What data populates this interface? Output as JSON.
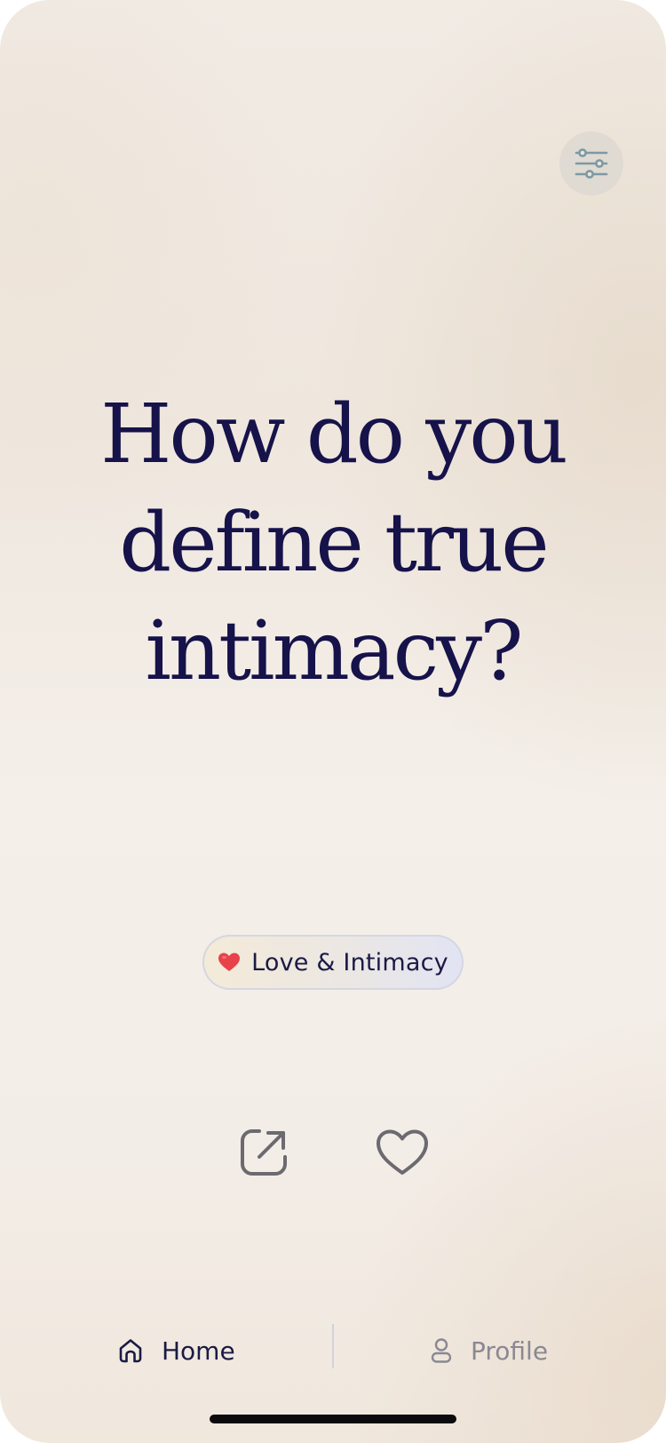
{
  "question": {
    "line1": "How do you",
    "line2": "define true",
    "line3": "intimacy?"
  },
  "category": {
    "emoji": "heart-emoji",
    "label": "Love & Intimacy"
  },
  "toolbar": {
    "filter_icon": "sliders-icon"
  },
  "actions": {
    "share_icon": "share-icon",
    "like_icon": "heart-icon"
  },
  "tabbar": {
    "home": {
      "label": "Home",
      "icon": "home-icon",
      "active": true
    },
    "profile": {
      "label": "Profile",
      "icon": "user-icon",
      "active": false
    }
  },
  "colors": {
    "text_primary": "#16124a",
    "icon_gray": "#6c6a70",
    "filter_icon": "#7d99a3",
    "heart_emoji": "#e8414a",
    "tab_inactive": "#8a8893"
  }
}
